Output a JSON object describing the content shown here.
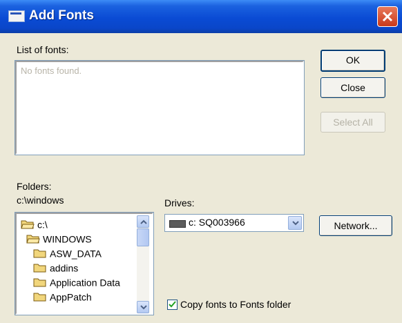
{
  "window": {
    "title": "Add Fonts"
  },
  "fonts": {
    "label": "List of fonts:",
    "empty_text": "No fonts found."
  },
  "buttons": {
    "ok": "OK",
    "close": "Close",
    "select_all": "Select All",
    "network": "Network..."
  },
  "folders": {
    "label": "Folders:",
    "current_path": "c:\\windows",
    "items": [
      {
        "label": "c:\\",
        "icon": "open-folder-icon"
      },
      {
        "label": "WINDOWS",
        "icon": "open-folder-icon"
      },
      {
        "label": "ASW_DATA",
        "icon": "folder-icon"
      },
      {
        "label": "addins",
        "icon": "folder-icon"
      },
      {
        "label": "Application Data",
        "icon": "folder-icon"
      },
      {
        "label": "AppPatch",
        "icon": "folder-icon"
      }
    ]
  },
  "drives": {
    "label": "Drives:",
    "selected": "c: SQ003966",
    "icon": "hard-drive-icon"
  },
  "options": {
    "copy_fonts_label": "Copy fonts to Fonts folder",
    "copy_fonts_checked": true
  },
  "colors": {
    "titlebar": "#0a4bd4",
    "dialog_bg": "#ece9d8",
    "folder": "#e8c84a"
  }
}
